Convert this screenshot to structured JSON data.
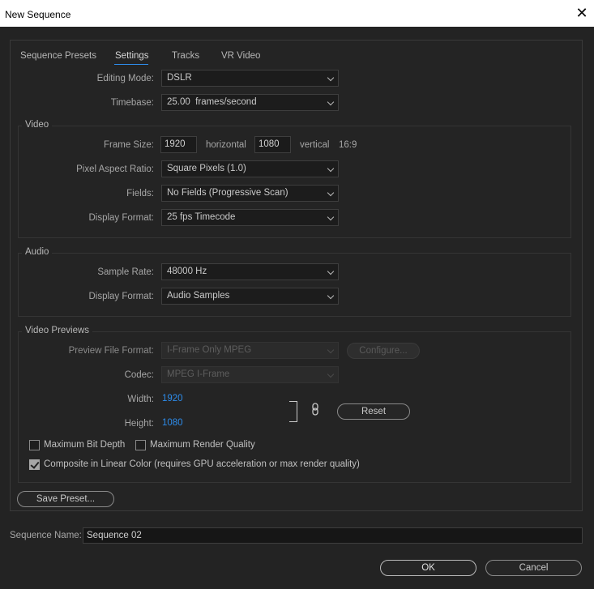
{
  "window": {
    "title": "New Sequence"
  },
  "tabs": [
    "Sequence Presets",
    "Settings",
    "Tracks",
    "VR Video"
  ],
  "settings": {
    "editing_mode": {
      "label": "Editing Mode:",
      "value": "DSLR"
    },
    "timebase": {
      "label": "Timebase:",
      "value": "25.00  frames/second"
    }
  },
  "video": {
    "title": "Video",
    "frame_size_label": "Frame Size:",
    "frame_width": "1920",
    "horizontal_label": "horizontal",
    "frame_height": "1080",
    "vertical_label": "vertical",
    "aspect": "16:9",
    "pixel_aspect": {
      "label": "Pixel Aspect Ratio:",
      "value": "Square Pixels (1.0)"
    },
    "fields": {
      "label": "Fields:",
      "value": "No Fields (Progressive Scan)"
    },
    "display_format": {
      "label": "Display Format:",
      "value": "25 fps Timecode"
    }
  },
  "audio": {
    "title": "Audio",
    "sample_rate": {
      "label": "Sample Rate:",
      "value": "48000 Hz"
    },
    "display_format": {
      "label": "Display Format:",
      "value": "Audio Samples"
    }
  },
  "previews": {
    "title": "Video Previews",
    "file_format": {
      "label": "Preview File Format:",
      "value": "I-Frame Only MPEG"
    },
    "configure_label": "Configure...",
    "codec": {
      "label": "Codec:",
      "value": "MPEG I-Frame"
    },
    "width": {
      "label": "Width:",
      "value": "1920"
    },
    "height": {
      "label": "Height:",
      "value": "1080"
    },
    "reset_label": "Reset",
    "max_bit_depth": {
      "label": "Maximum Bit Depth",
      "checked": false
    },
    "max_render_quality": {
      "label": "Maximum Render Quality",
      "checked": false
    },
    "composite_linear": {
      "label": "Composite in Linear Color (requires GPU acceleration or max render quality)",
      "checked": true
    }
  },
  "save_preset_label": "Save Preset...",
  "sequence_name": {
    "label": "Sequence Name:",
    "value": "Sequence 02"
  },
  "buttons": {
    "ok": "OK",
    "cancel": "Cancel"
  },
  "colors": {
    "accent": "#2d8ceb",
    "background": "#232323"
  },
  "icons": {
    "close": "close-icon",
    "link": "link-icon",
    "dropdown": "chevron-down-icon"
  }
}
